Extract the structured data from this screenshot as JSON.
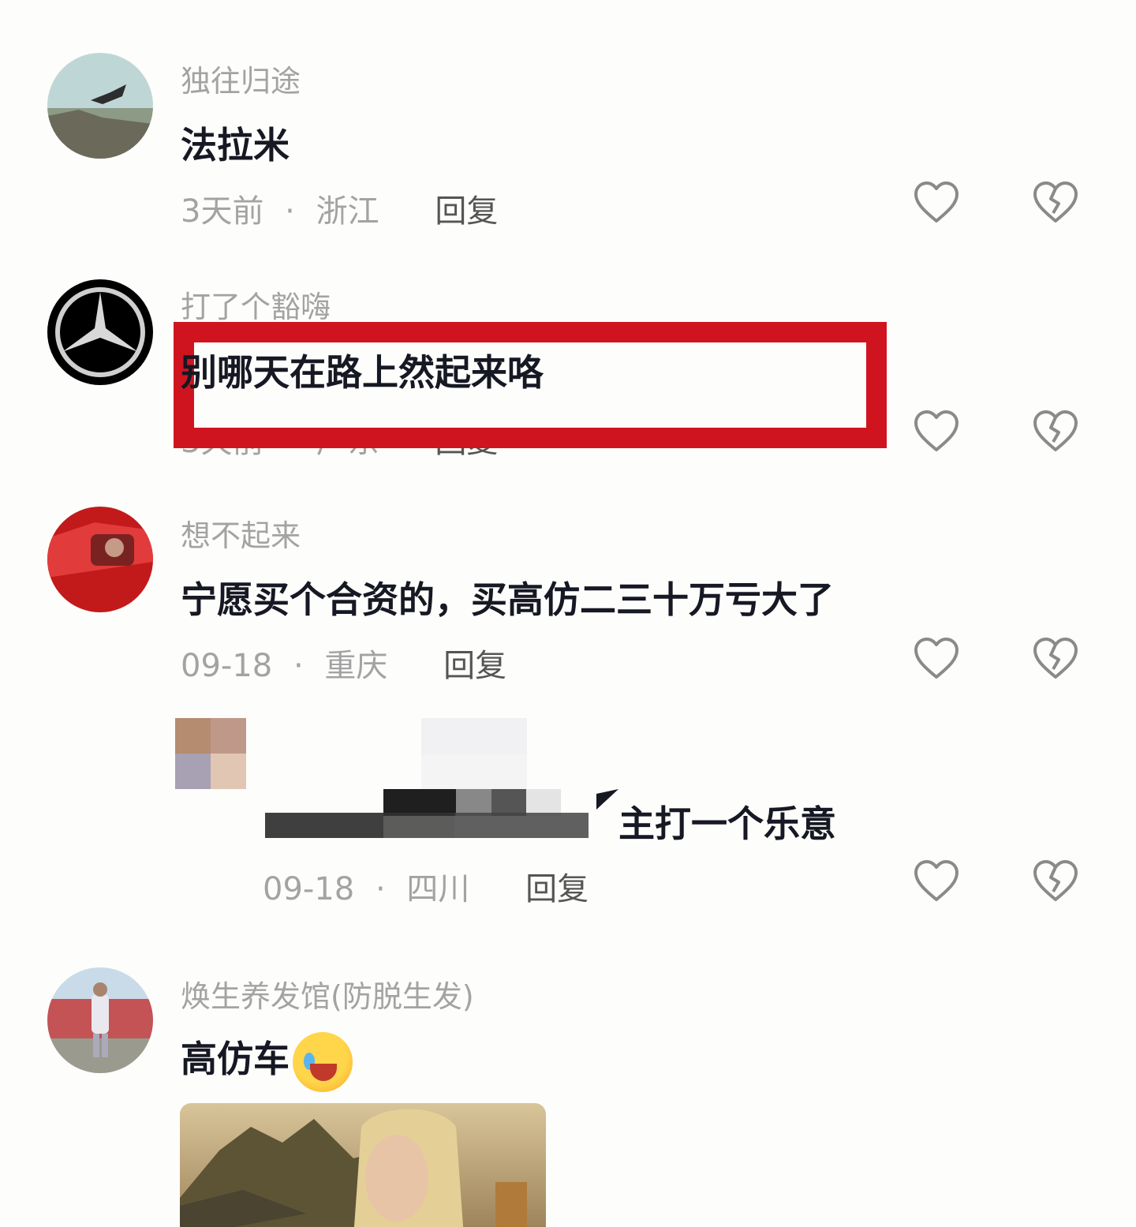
{
  "comments": [
    {
      "user": "独往归途",
      "text": "法拉米",
      "time": "3天前",
      "sep": "·",
      "location": "浙江",
      "reply": "回复"
    },
    {
      "user": "打了个豁嗨",
      "text": "别哪天在路上然起来咯",
      "time": "3天前",
      "sep": "·",
      "location": "广东",
      "reply": "回复"
    },
    {
      "user": "想不起来",
      "text": "宁愿买个合资的，买高仿二三十万亏大了",
      "time": "09-18",
      "sep": "·",
      "location": "重庆",
      "reply": "回复"
    },
    {
      "user": "",
      "text": "主打一个乐意",
      "time": "09-18",
      "sep": "·",
      "location": "四川",
      "reply": "回复"
    },
    {
      "user": "焕生养发馆(防脱生发)",
      "text": "高仿车",
      "emoji": "face-holding-back-tears-icon"
    }
  ],
  "icons": {
    "like": "heart-outline-icon",
    "dislike": "broken-heart-icon"
  },
  "colors": {
    "highlight": "#d0141f",
    "username": "#a3a3a3",
    "text": "#161823"
  }
}
